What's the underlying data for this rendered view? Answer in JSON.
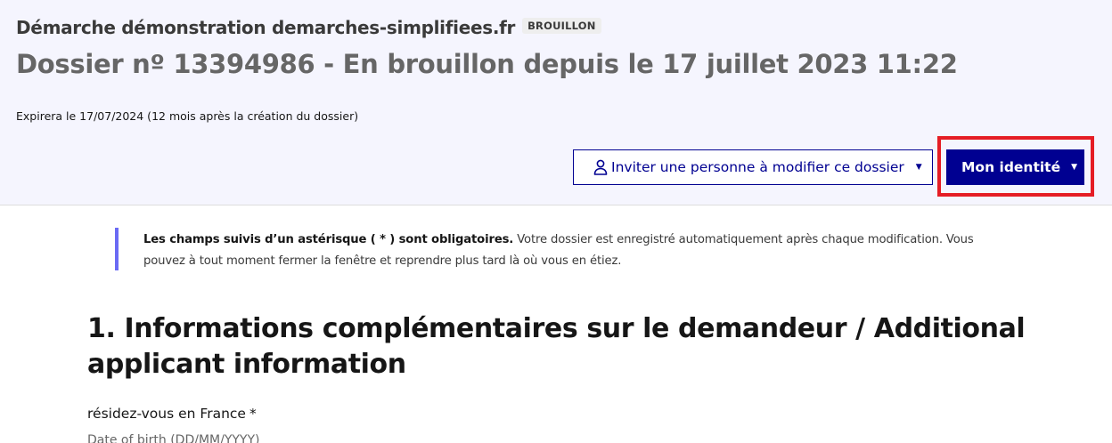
{
  "header": {
    "procedure_title": "Démarche démonstration demarches-simplifiees.fr",
    "status_badge": "BROUILLON",
    "dossier_title": "Dossier nº 13394986 - En brouillon depuis le 17 juillet 2023 11:22",
    "expiry": "Expirera le 17/07/2024 (12 mois après la création du dossier)"
  },
  "actions": {
    "invite_label": "Inviter une personne à modifier ce dossier",
    "identity_label": "Mon identité",
    "caret": "▼",
    "user_icon": "user-icon",
    "highlight_color": "#e51d25"
  },
  "notice": {
    "bold": "Les champs suivis d’un astérisque ( * ) sont obligatoires.",
    "text": " Votre dossier est enregistré automatiquement après chaque modification. Vous pouvez à tout moment fermer la fenêtre et reprendre plus tard là où vous en étiez."
  },
  "section": {
    "title": "1. Informations complémentaires sur le demandeur / Additional applicant information"
  },
  "field": {
    "label": "résidez-vous en France",
    "required_marker": "*",
    "hint": "Date of birth (DD/MM/YYYY)"
  },
  "colors": {
    "primary": "#000091",
    "header_bg": "#f5f5fe",
    "notice_border": "#6a6af4"
  }
}
